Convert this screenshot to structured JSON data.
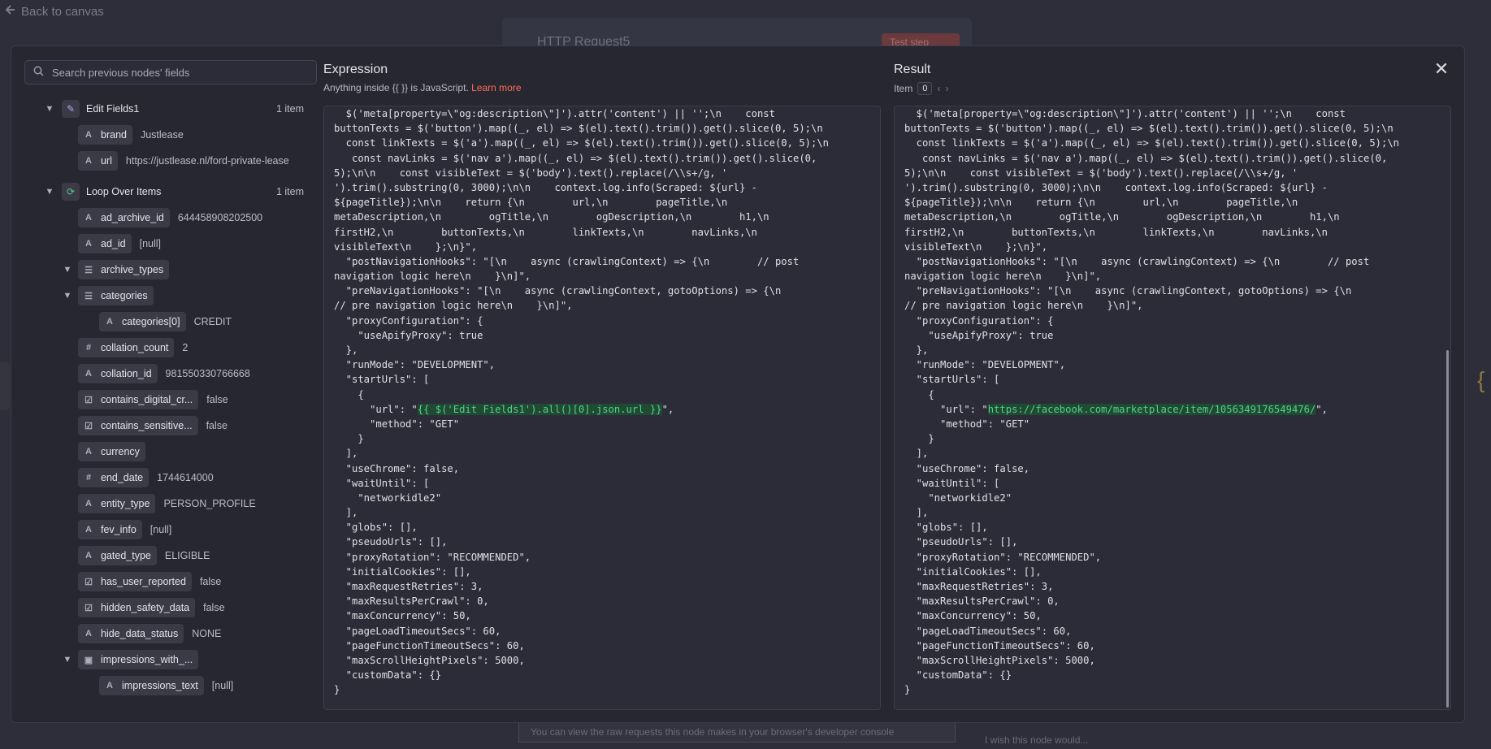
{
  "background": {
    "back_label": "Back to canvas",
    "node_title": "HTTP Request5",
    "test_button": "Test step",
    "hint": "You can view the raw requests this node makes in your browser's developer console",
    "wish": "I wish this node would..."
  },
  "search": {
    "placeholder": "Search previous nodes' fields"
  },
  "tree": {
    "edit_fields": {
      "label": "Edit Fields1",
      "count": "1 item"
    },
    "brand": {
      "key": "brand",
      "value": "Justlease"
    },
    "url": {
      "key": "url",
      "value": "https://justlease.nl/ford-private-lease"
    },
    "loop": {
      "label": "Loop Over Items",
      "count": "1 item"
    },
    "fields": [
      {
        "key": "ad_archive_id",
        "value": "644458908202500",
        "type": "A"
      },
      {
        "key": "ad_id",
        "value": "[null]",
        "type": "A"
      },
      {
        "key": "archive_types",
        "value": "",
        "type": "list"
      },
      {
        "key": "categories",
        "value": "",
        "type": "list"
      },
      {
        "key": "categories[0]",
        "value": "CREDIT",
        "type": "A"
      },
      {
        "key": "collation_count",
        "value": "2",
        "type": "#"
      },
      {
        "key": "collation_id",
        "value": "981550330766668",
        "type": "A"
      },
      {
        "key": "contains_digital_cr...",
        "value": "false",
        "type": "bool"
      },
      {
        "key": "contains_sensitive...",
        "value": "false",
        "type": "bool"
      },
      {
        "key": "currency",
        "value": "",
        "type": "A"
      },
      {
        "key": "end_date",
        "value": "1744614000",
        "type": "#"
      },
      {
        "key": "entity_type",
        "value": "PERSON_PROFILE",
        "type": "A"
      },
      {
        "key": "fev_info",
        "value": "[null]",
        "type": "A"
      },
      {
        "key": "gated_type",
        "value": "ELIGIBLE",
        "type": "A"
      },
      {
        "key": "has_user_reported",
        "value": "false",
        "type": "bool"
      },
      {
        "key": "hidden_safety_data",
        "value": "false",
        "type": "bool"
      },
      {
        "key": "hide_data_status",
        "value": "NONE",
        "type": "A"
      },
      {
        "key": "impressions_with_...",
        "value": "",
        "type": "obj"
      },
      {
        "key": "impressions_text",
        "value": "[null]",
        "type": "A"
      }
    ]
  },
  "expression": {
    "title": "Expression",
    "subtitle_prefix": "Anything inside {{ }} is JavaScript.",
    "learn_more": "Learn more",
    "lines": [
      "  $('meta[property=\\\"og:description\\\"]').attr('content') || '';\\n    const",
      "buttonTexts = $('button').map((_, el) => $(el).text().trim()).get().slice(0, 5);\\n",
      "  const linkTexts = $('a').map((_, el) => $(el).text().trim()).get().slice(0, 5);\\n",
      "   const navLinks = $('nav a').map((_, el) => $(el).text().trim()).get().slice(0,",
      "5);\\n\\n    const visibleText = $('body').text().replace(/\\\\s+/g, '",
      "').trim().substring(0, 3000);\\n\\n    context.log.info(Scraped: ${url} -",
      "${pageTitle});\\n\\n    return {\\n        url,\\n        pageTitle,\\n",
      "metaDescription,\\n        ogTitle,\\n        ogDescription,\\n        h1,\\n",
      "firstH2,\\n        buttonTexts,\\n        linkTexts,\\n        navLinks,\\n",
      "visibleText\\n    };\\n}\",",
      "  \"postNavigationHooks\": \"[\\n    async (crawlingContext) => {\\n        // post",
      "navigation logic here\\n    }\\n]\",",
      "  \"preNavigationHooks\": \"[\\n    async (crawlingContext, gotoOptions) => {\\n",
      "// pre navigation logic here\\n    }\\n]\",",
      "  \"proxyConfiguration\": {",
      "    \"useApifyProxy\": true",
      "  },",
      "  \"runMode\": \"DEVELOPMENT\",",
      "  \"startUrls\": [",
      "    {",
      "      \"url\": \"",
      "      \"method\": \"GET\"",
      "    }",
      "  ],",
      "  \"useChrome\": false,",
      "  \"waitUntil\": [",
      "    \"networkidle2\"",
      "  ],",
      "  \"globs\": [],",
      "  \"pseudoUrls\": [],",
      "  \"proxyRotation\": \"RECOMMENDED\",",
      "  \"initialCookies\": [],",
      "  \"maxRequestRetries\": 3,",
      "  \"maxResultsPerCrawl\": 0,",
      "  \"maxConcurrency\": 50,",
      "  \"pageLoadTimeoutSecs\": 60,",
      "  \"pageFunctionTimeoutSecs\": 60,",
      "  \"maxScrollHeightPixels\": 5000,",
      "  \"customData\": {}",
      "}"
    ],
    "url_expr": "{{ $('Edit Fields1').all()[0].json.url }}",
    "url_suffix": "\","
  },
  "result": {
    "title": "Result",
    "item_label": "Item",
    "item_value": "0",
    "url_value": "https://facebook.com/marketplace/item/1056349176549476/",
    "url_suffix": "\","
  }
}
